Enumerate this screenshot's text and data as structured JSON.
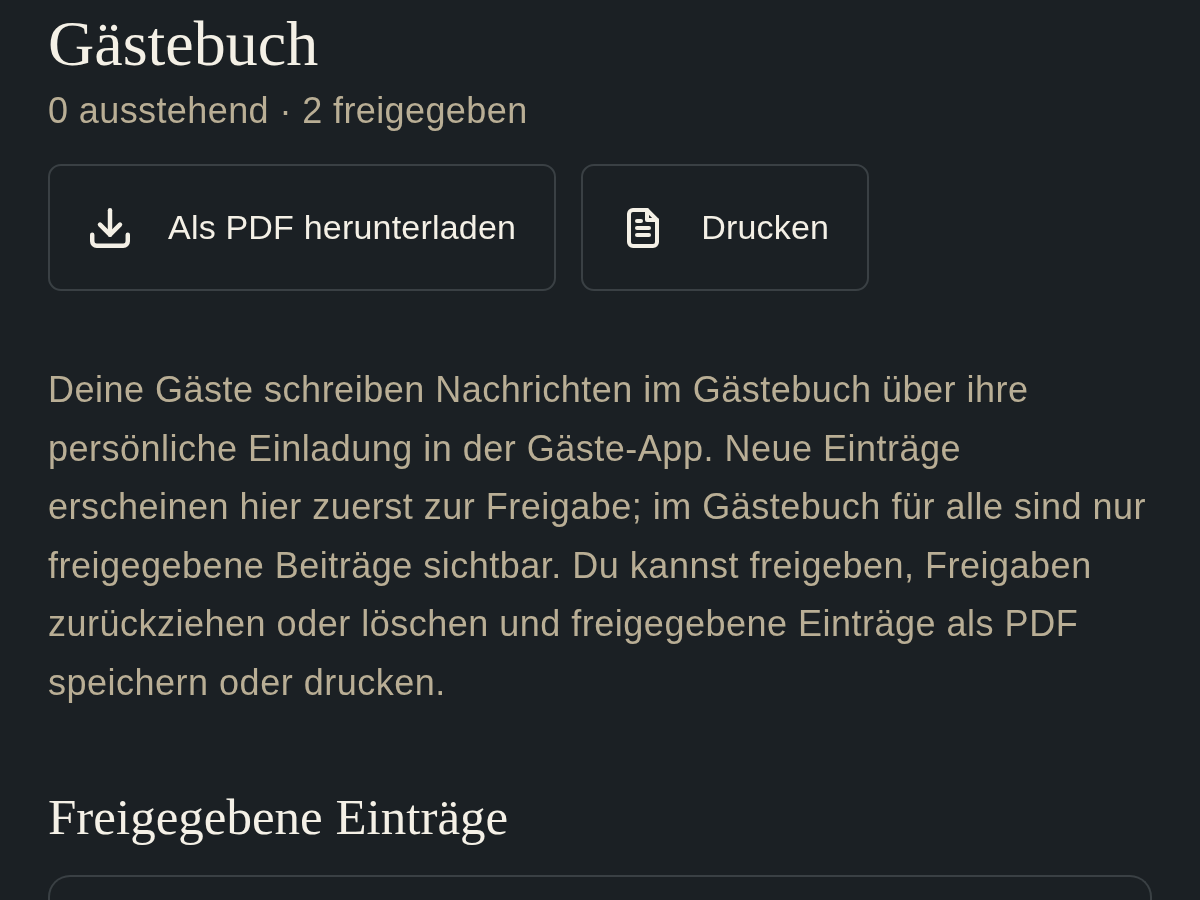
{
  "header": {
    "title": "Gästebuch",
    "summary": "0 ausstehend · 2 freigegeben"
  },
  "actions": [
    {
      "kind": "download",
      "label": "Als PDF herunterladen"
    },
    {
      "kind": "print",
      "label": "Drucken"
    }
  ],
  "description": "Deine Gäste schreiben Nachrichten im Gästebuch über ihre persönliche Einladung in der Gäste-App. Neue Einträge erscheinen hier zuerst zur Freigabe; im Gästebuch für alle sind nur freigegebene Beiträge sichtbar. Du kannst freigeben, Freigaben zurückziehen oder löschen und freigegebene Einträge als PDF speichern oder drucken.",
  "approved_section": {
    "title": "Freigegebene Einträge"
  }
}
